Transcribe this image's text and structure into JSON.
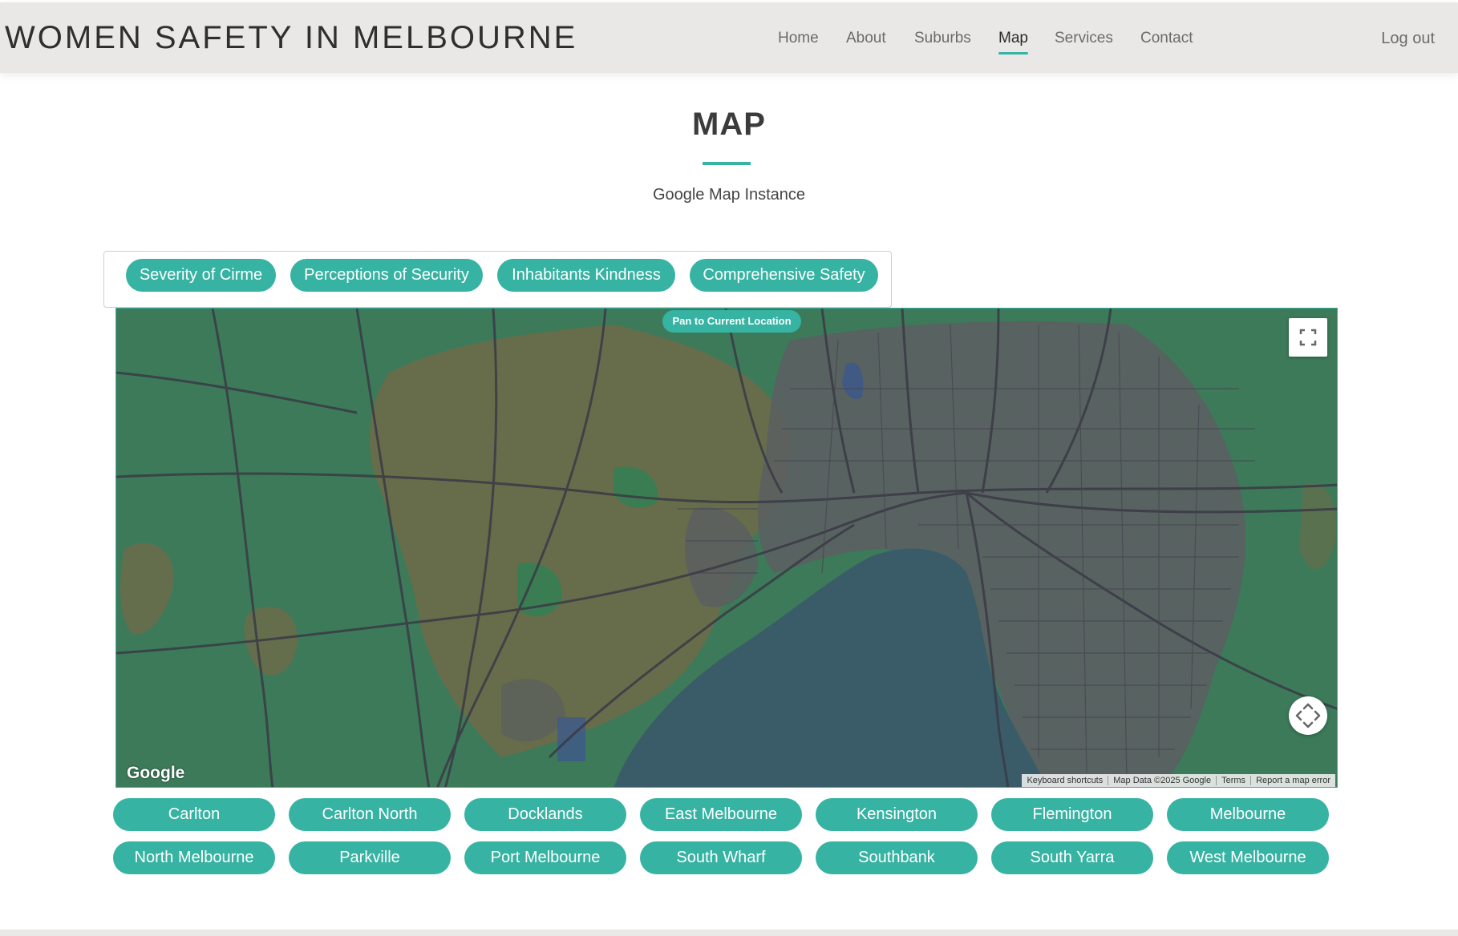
{
  "header": {
    "brand": "WOMEN SAFETY IN MELBOURNE",
    "nav": [
      "Home",
      "About",
      "Suburbs",
      "Map",
      "Services",
      "Contact"
    ],
    "active": "Map",
    "logout": "Log out"
  },
  "main": {
    "title": "MAP",
    "subtitle": "Google Map Instance"
  },
  "filters": [
    "Severity of Cirme",
    "Perceptions of Security",
    "Inhabitants Kindness",
    "Comprehensive Safety"
  ],
  "map": {
    "pan_button": "Pan to Current Location",
    "google_logo": "Google",
    "attribution": {
      "keyboard": "Keyboard shortcuts",
      "data": "Map Data ©2025 Google",
      "terms": "Terms",
      "report": "Report a map error"
    },
    "fullscreen_icon": "fullscreen-icon",
    "move_icon": "move-arrows-icon"
  },
  "suburbs": {
    "row1": [
      "Carlton",
      "Carlton North",
      "Docklands",
      "East Melbourne",
      "Kensington",
      "Flemington",
      "Melbourne"
    ],
    "row2": [
      "North Melbourne",
      "Parkville",
      "Port Melbourne",
      "South Wharf",
      "Southbank",
      "South Yarra",
      "West Melbourne"
    ]
  },
  "colors": {
    "accent": "#36b3a2",
    "navbar_bg": "#e9e8e6",
    "map_land": "#3c7a5a",
    "map_bay": "#395c68"
  }
}
